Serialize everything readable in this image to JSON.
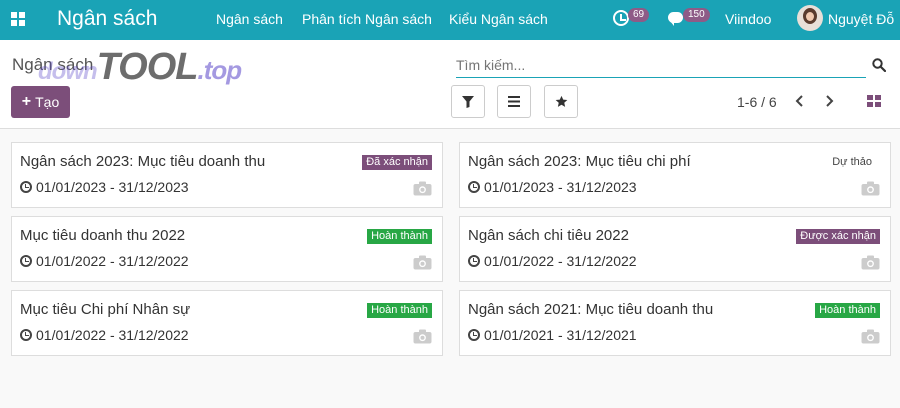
{
  "topbar": {
    "brand": "Ngân sách",
    "menu": [
      "Ngân sách",
      "Phân tích Ngân sách",
      "Kiểu Ngân sách"
    ],
    "activity_count": "69",
    "message_count": "150",
    "company": "Viindoo",
    "user_name": "Nguyệt Đỗ"
  },
  "control": {
    "title": "Ngân sách",
    "watermark_pre": "down",
    "watermark_main": "TOOL",
    "watermark_suffix": ".top",
    "search_placeholder": "Tìm kiếm...",
    "create_label": "Tạo",
    "pager": "1-6 / 6"
  },
  "cards": [
    {
      "title": "Ngân sách 2023: Mục tiêu doanh thu",
      "dates": "01/01/2023 - 31/12/2023",
      "status": "Đã xác nhận",
      "status_color": "#7c4e7a"
    },
    {
      "title": "Ngân sách 2023: Mục tiêu chi phí",
      "dates": "01/01/2023 - 31/12/2023",
      "status": "Dự thảo",
      "status_color": "transparent"
    },
    {
      "title": "Mục tiêu doanh thu 2022",
      "dates": "01/01/2022 - 31/12/2022",
      "status": "Hoàn thành",
      "status_color": "#28a745"
    },
    {
      "title": "Ngân sách chi tiêu 2022",
      "dates": "01/01/2022 - 31/12/2022",
      "status": "Được xác nhận",
      "status_color": "#7c4e7a"
    },
    {
      "title": "Mục tiêu Chi phí Nhân sự",
      "dates": "01/01/2022 - 31/12/2022",
      "status": "Hoàn thành",
      "status_color": "#28a745"
    },
    {
      "title": "Ngân sách 2021: Mục tiêu doanh thu",
      "dates": "01/01/2021 - 31/12/2021",
      "status": "Hoàn thành",
      "status_color": "#28a745"
    }
  ],
  "colors": {
    "topbar": "#1aa3b6",
    "primary": "#7c4e7a",
    "success": "#28a745"
  }
}
